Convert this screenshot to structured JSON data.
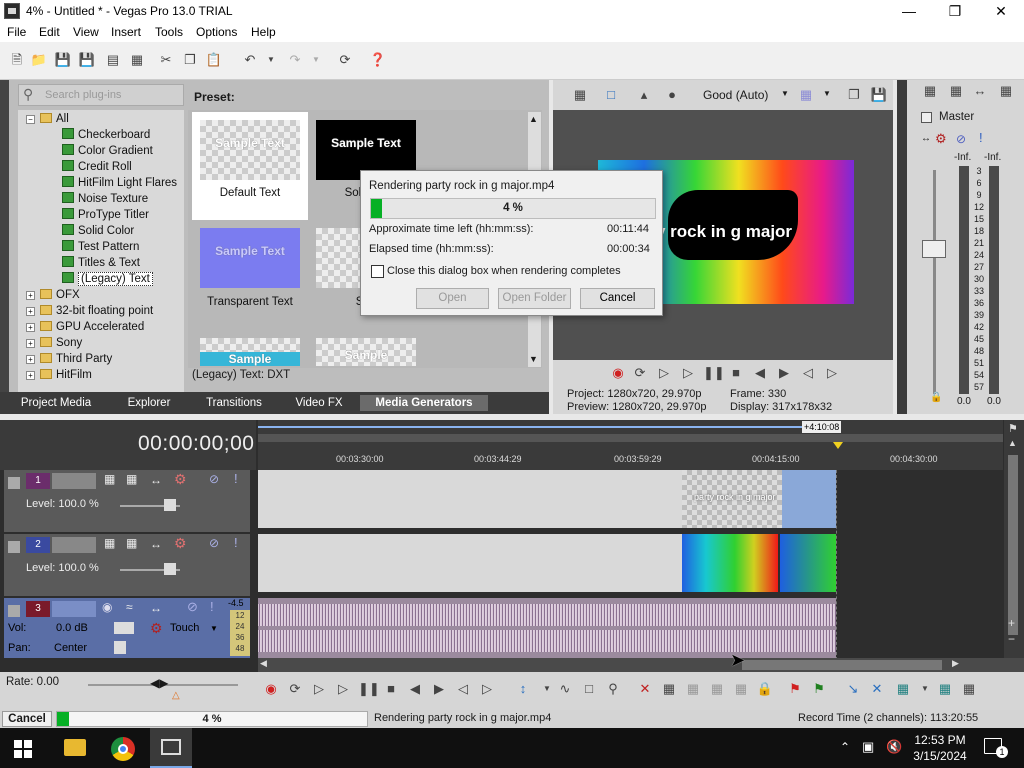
{
  "window": {
    "title": "4% - Untitled * - Vegas Pro 13.0 TRIAL"
  },
  "menu": [
    "File",
    "Edit",
    "View",
    "Insert",
    "Tools",
    "Options",
    "Help"
  ],
  "plugins": {
    "search_placeholder": "Search plug-ins",
    "preset_label": "Preset:",
    "tree": [
      {
        "label": "All",
        "type": "folder",
        "expanded": true
      },
      {
        "label": "Checkerboard",
        "type": "fx"
      },
      {
        "label": "Color Gradient",
        "type": "fx"
      },
      {
        "label": "Credit Roll",
        "type": "fx"
      },
      {
        "label": "HitFilm Light Flares",
        "type": "fx"
      },
      {
        "label": "Noise Texture",
        "type": "fx"
      },
      {
        "label": "ProType Titler",
        "type": "fx"
      },
      {
        "label": "Solid Color",
        "type": "fx"
      },
      {
        "label": "Test Pattern",
        "type": "fx"
      },
      {
        "label": "Titles & Text",
        "type": "fx"
      },
      {
        "label": "(Legacy) Text",
        "type": "fx",
        "selected": true
      },
      {
        "label": "OFX",
        "type": "folder"
      },
      {
        "label": "32-bit floating point",
        "type": "folder"
      },
      {
        "label": "GPU Accelerated",
        "type": "folder"
      },
      {
        "label": "Sony",
        "type": "folder"
      },
      {
        "label": "Third Party",
        "type": "folder"
      },
      {
        "label": "HitFilm",
        "type": "folder"
      }
    ],
    "presets": [
      {
        "thumb_text": "Sample Text",
        "caption": "Default Text"
      },
      {
        "thumb_text": "Sample Text",
        "caption": "Solid Ba"
      },
      {
        "thumb_text": "Sample Text",
        "caption": "Transparent Text"
      },
      {
        "thumb_text": "Sa",
        "caption": "Soft"
      },
      {
        "thumb_text": "Sample",
        "caption": ""
      },
      {
        "thumb_text": "Sample",
        "caption": ""
      }
    ],
    "preset_status": "(Legacy) Text: DXT"
  },
  "tabs": [
    "Project Media",
    "Explorer",
    "Transitions",
    "Video FX",
    "Media Generators"
  ],
  "preview": {
    "quality": "Good (Auto)",
    "overlay_text": "y rock in g major",
    "project": "Project:  1280x720, 29.970p",
    "preview_info": "Preview:  1280x720, 29.970p",
    "frame": "Frame:     330",
    "display": "Display:   317x178x32"
  },
  "master": {
    "label": "Master",
    "left_inf": "-Inf.",
    "right_inf": "-Inf.",
    "scale": [
      "3",
      "6",
      "9",
      "12",
      "15",
      "18",
      "21",
      "24",
      "27",
      "30",
      "33",
      "36",
      "39",
      "42",
      "45",
      "48",
      "51",
      "54",
      "57"
    ],
    "left_value": "0.0",
    "right_value": "0.0"
  },
  "timeline": {
    "timecode": "00:00:00;00",
    "ruler_marker": "+4:10:08",
    "ruler_labels": [
      "00:03:30:00",
      "00:03:44:29",
      "00:03:59:29",
      "00:04:15:00",
      "00:04:30:00"
    ],
    "tracks": [
      {
        "number": "1",
        "level": "Level: 100.0 %",
        "clip_text": "party rock in g major"
      },
      {
        "number": "2",
        "level": "Level: 100.0 %"
      },
      {
        "number": "3",
        "vol": "Vol:",
        "vol_value": "0.0 dB",
        "pan": "Pan:",
        "pan_value": "Center",
        "mode": "Touch",
        "meter_top": "-4.5",
        "meter_scale": [
          "12",
          "24",
          "36",
          "48"
        ]
      }
    ],
    "rate": "Rate: 0.00"
  },
  "dialog": {
    "title": "Rendering party rock in g major.mp4",
    "progress_pct": 4,
    "progress_text": "4 %",
    "time_left_label": "Approximate time left (hh:mm:ss):",
    "time_left": "00:11:44",
    "elapsed_label": "Elapsed time (hh:mm:ss):",
    "elapsed": "00:00:34",
    "checkbox_label": "Close this dialog box when rendering completes",
    "open": "Open",
    "open_folder": "Open Folder",
    "cancel": "Cancel"
  },
  "status": {
    "cancel": "Cancel",
    "progress_pct": 4,
    "progress_text": "4 %",
    "message": "Rendering party rock in g major.mp4",
    "record_time": "Record Time (2 channels): 113:20:55"
  },
  "taskbar": {
    "time": "12:53 PM",
    "date": "3/15/2024"
  },
  "colors": {
    "accent_green": "#2aa52a",
    "selection_blue": "#3d6fbf",
    "panel_dark": "#3b3b3b"
  }
}
